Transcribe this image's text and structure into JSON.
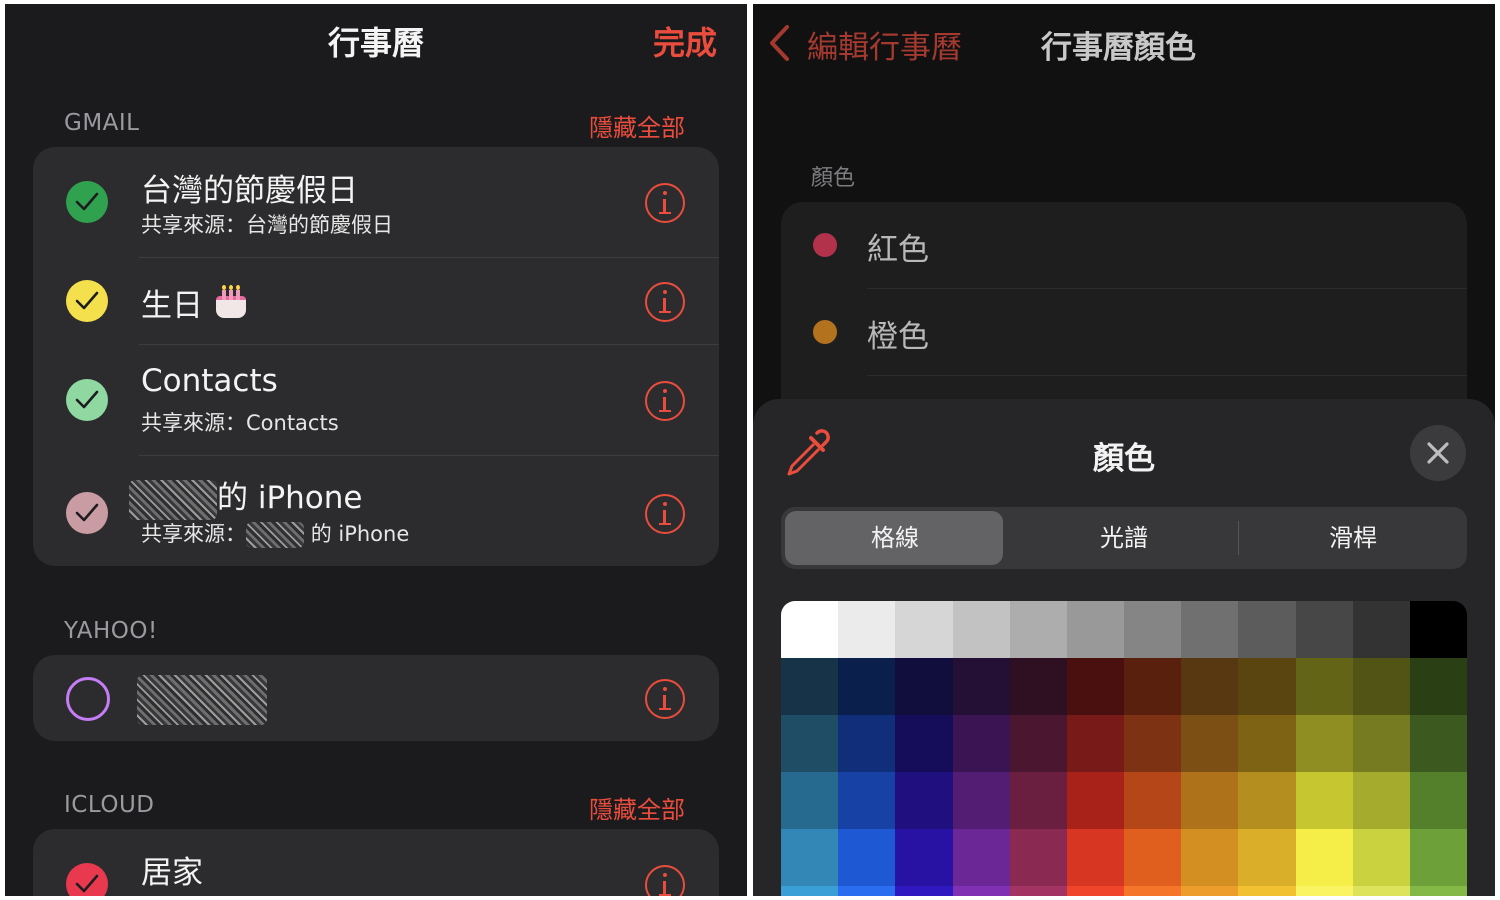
{
  "left": {
    "title": "行事曆",
    "done": "完成",
    "sections": [
      {
        "label": "GMAIL",
        "hide_all": "隱藏全部",
        "items": [
          {
            "title": "台灣的節慶假日",
            "subtitle": "共享來源：台灣的節慶假日",
            "color": "#30a14e",
            "checked": true
          },
          {
            "title": "生日",
            "subtitle": "",
            "color": "#f4e04c",
            "checked": true
          },
          {
            "title": "Contacts",
            "subtitle": "共享來源：Contacts",
            "color": "#8fd8a2",
            "checked": true
          },
          {
            "title": "的 iPhone",
            "subtitle_prefix": "共享來源：",
            "subtitle_suffix": "的 iPhone",
            "color": "#c99ca3",
            "checked": true
          }
        ]
      },
      {
        "label": "YAHOO!",
        "items": [
          {
            "title": "",
            "color": "#c57df5",
            "checked": false
          }
        ]
      },
      {
        "label": "ICLOUD",
        "hide_all": "隱藏全部",
        "items": [
          {
            "title": "居家",
            "color": "#e8394f",
            "checked": true
          }
        ]
      }
    ]
  },
  "right": {
    "back_label": "編輯行事曆",
    "title": "行事曆顏色",
    "color_section_label": "顏色",
    "colors": [
      {
        "name": "紅色",
        "hex": "#b2324b"
      },
      {
        "name": "橙色",
        "hex": "#b3731e"
      }
    ],
    "picker": {
      "title": "顏色",
      "tabs": [
        "格線",
        "光譜",
        "滑桿"
      ],
      "active_tab": 0,
      "grid_rows": [
        [
          "#ffffff",
          "#ebebeb",
          "#d6d6d6",
          "#c2c2c2",
          "#adadad",
          "#999999",
          "#858585",
          "#707070",
          "#5c5c5c",
          "#474747",
          "#333333",
          "#000000"
        ],
        [
          "#173347",
          "#0b1f4d",
          "#110d3d",
          "#241035",
          "#2f0f22",
          "#4a0f0f",
          "#5a200e",
          "#573810",
          "#5a4410",
          "#646417",
          "#525416",
          "#2a3f14"
        ],
        [
          "#1f4d66",
          "#112e7a",
          "#160d5a",
          "#3b1454",
          "#4b1630",
          "#781a17",
          "#7c3213",
          "#7c5014",
          "#7f6315",
          "#8e8e22",
          "#767a20",
          "#3c5a1f"
        ],
        [
          "#276a8f",
          "#1841a6",
          "#200f7f",
          "#531d74",
          "#6b1f40",
          "#a92219",
          "#b44617",
          "#ae721a",
          "#b48e1f",
          "#c5c630",
          "#a5ab2d",
          "#54802c"
        ],
        [
          "#3387b6",
          "#1f58d3",
          "#2712a3",
          "#6c2796",
          "#8a2a52",
          "#d73622",
          "#e05f1f",
          "#d48f23",
          "#dbae2a",
          "#f5ee48",
          "#cbd23f",
          "#6ea03a"
        ],
        [
          "#3a9fd6",
          "#2b6df0",
          "#3018c0",
          "#8030b2",
          "#a33363",
          "#f0452b",
          "#f5762a",
          "#ec9d2b",
          "#f1c131",
          "#fbf462",
          "#dde35a",
          "#84b847"
        ]
      ]
    }
  }
}
